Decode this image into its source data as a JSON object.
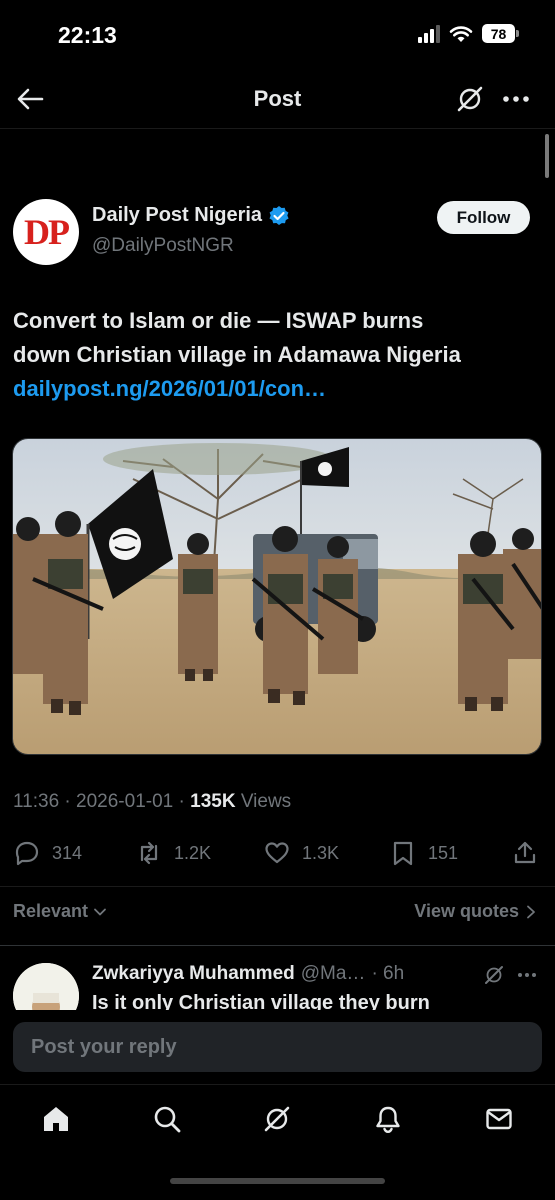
{
  "status_bar": {
    "time": "22:13",
    "battery": "78"
  },
  "header": {
    "title": "Post",
    "back_icon": "arrow-left-icon",
    "grok_icon": "grok-icon",
    "more_icon": "more-horizontal-icon"
  },
  "post": {
    "author": {
      "name": "Daily Post Nigeria",
      "handle": "@DailyPostNGR",
      "avatar_text": "DP",
      "verified": true
    },
    "follow_label": "Follow",
    "text_line1": "Convert to Islam or die — ISWAP burns",
    "text_line2": "down Christian village in Adamawa Nigeria",
    "link": "dailypost.ng/2026/01/01/con…",
    "media_alt": "photo",
    "meta": {
      "time": "11:36",
      "sep1": " · ",
      "date": "2026-01-01",
      "sep2": " · ",
      "views": "135K",
      "views_label": " Views"
    },
    "actions": {
      "replies": "314",
      "reposts": "1.2K",
      "likes": "1.3K",
      "bookmarks": "151"
    }
  },
  "replies_bar": {
    "sort_label": "Relevant",
    "quotes_label": "View quotes"
  },
  "reply_preview": {
    "name": "Zwkariyya Muhammed",
    "handle": "@Ma…",
    "time": "· 6h",
    "text": "Is it only Christian village they burn"
  },
  "composer": {
    "placeholder": "Post your reply"
  },
  "bottom_nav": [
    "home-icon",
    "search-icon",
    "grok-icon",
    "notifications-icon",
    "messages-icon"
  ],
  "colors": {
    "background": "#000000",
    "text": "#e7e9ea",
    "secondary": "#71767b",
    "link": "#1d9bf0",
    "verified": "#1d9bf0",
    "brand_red": "#d7211d"
  }
}
